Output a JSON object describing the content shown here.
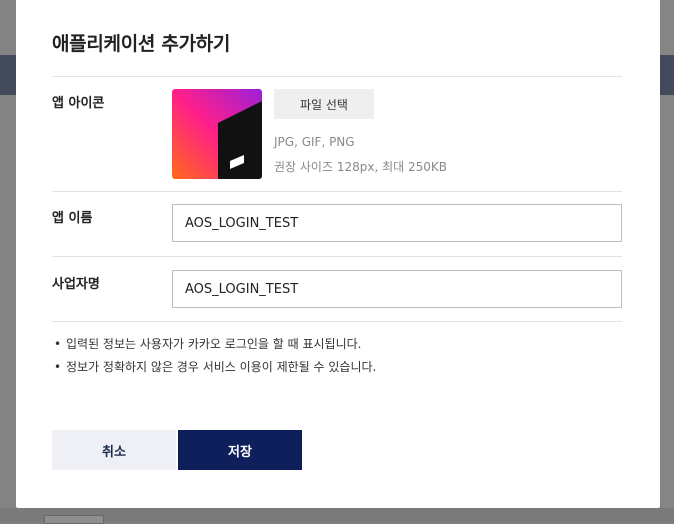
{
  "modal": {
    "title": "애플리케이션 추가하기",
    "icon_row": {
      "label": "앱 아이콘",
      "file_button": "파일 선택",
      "hint_formats": "JPG, GIF, PNG",
      "hint_size": "권장 사이즈 128px, 최대 250KB"
    },
    "app_name_row": {
      "label": "앱 이름",
      "value": "AOS_LOGIN_TEST"
    },
    "business_row": {
      "label": "사업자명",
      "value": "AOS_LOGIN_TEST"
    },
    "notices": [
      "입력된 정보는 사용자가 카카오 로그인을 할 때 표시됩니다.",
      "정보가 정확하지 않은 경우 서비스 이용이 제한될 수 있습니다."
    ],
    "bullet": "•",
    "buttons": {
      "cancel": "취소",
      "save": "저장"
    }
  },
  "colors": {
    "save_button": "#0e1f5b",
    "cancel_button": "#eef0f6",
    "icon_gradient_start": "#ff6a1a",
    "icon_gradient_mid": "#ff1f8a",
    "icon_gradient_end": "#9b1fd9"
  },
  "icons": {
    "app_icon": "app-logo-gradient-icon"
  }
}
